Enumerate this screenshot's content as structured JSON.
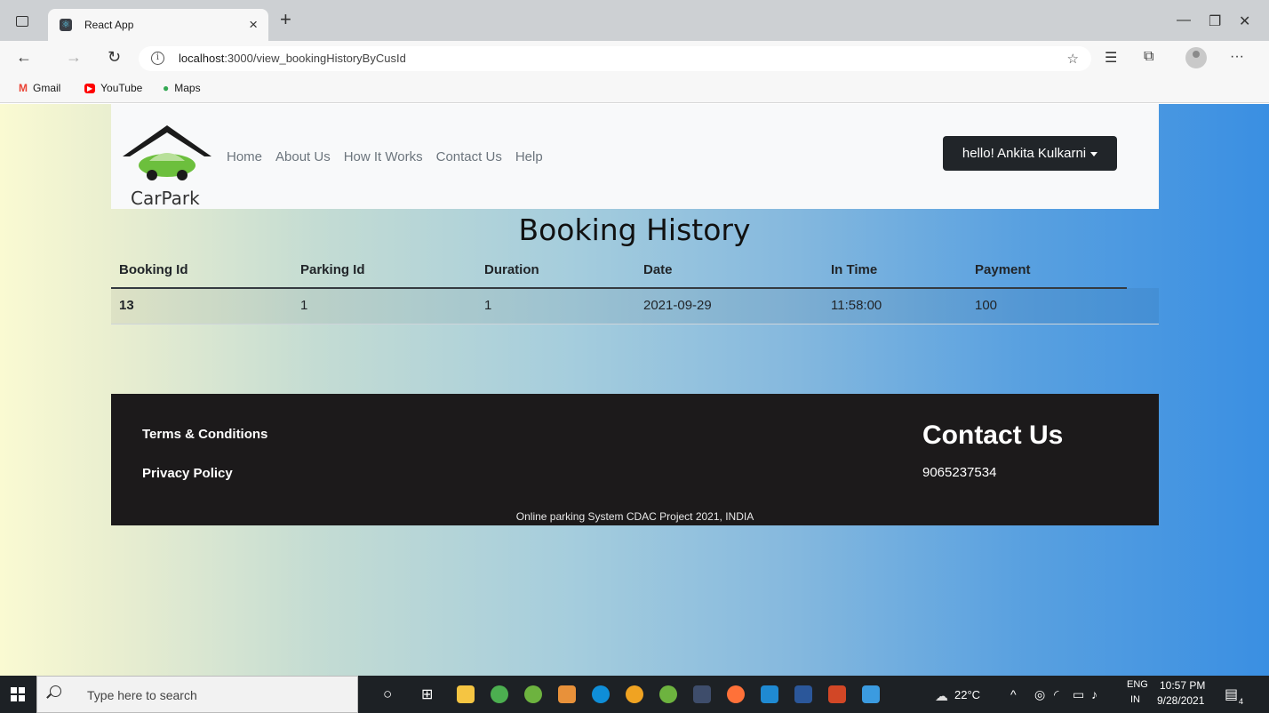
{
  "browser": {
    "tab_title": "React App",
    "tab_close": "×",
    "new_tab": "+",
    "url_host": "localhost",
    "url_path": ":3000/view_bookingHistoryByCusId",
    "bookmarks": [
      {
        "label": "Gmail",
        "icon": "gmail-icon",
        "color": "#ea4335"
      },
      {
        "label": "YouTube",
        "icon": "youtube-icon",
        "color": "#ff0000"
      },
      {
        "label": "Maps",
        "icon": "maps-icon",
        "color": "#34a853"
      }
    ]
  },
  "site": {
    "logo_text": "CarPark",
    "nav_links": [
      "Home",
      "About Us",
      "How It Works",
      "Contact Us",
      "Help"
    ],
    "user_menu": "hello! Ankita Kulkarni"
  },
  "page_title": "Booking History",
  "table": {
    "columns": [
      "Booking Id",
      "Parking Id",
      "Duration",
      "Date",
      "In Time",
      "Payment"
    ],
    "rows": [
      [
        "13",
        "1",
        "1",
        "2021-09-29",
        "11:58:00",
        "100"
      ]
    ]
  },
  "footer": {
    "links": [
      "Terms & Conditions",
      "Privacy Policy"
    ],
    "contact_title": "Contact Us",
    "phone": "9065237534",
    "copyright": "Online parking System CDAC Project 2021, INDIA"
  },
  "taskbar": {
    "search_placeholder": "Type here to search",
    "weather": "22°C",
    "language": "ENG",
    "region": "IN",
    "time": "10:57 PM",
    "date": "9/28/2021",
    "notification_count": "4"
  },
  "colors": {
    "nav_bg": "#f8f9fa",
    "footer_bg": "#1c1a1b",
    "user_button_bg": "#212529",
    "car_green": "#6cbf3d"
  }
}
